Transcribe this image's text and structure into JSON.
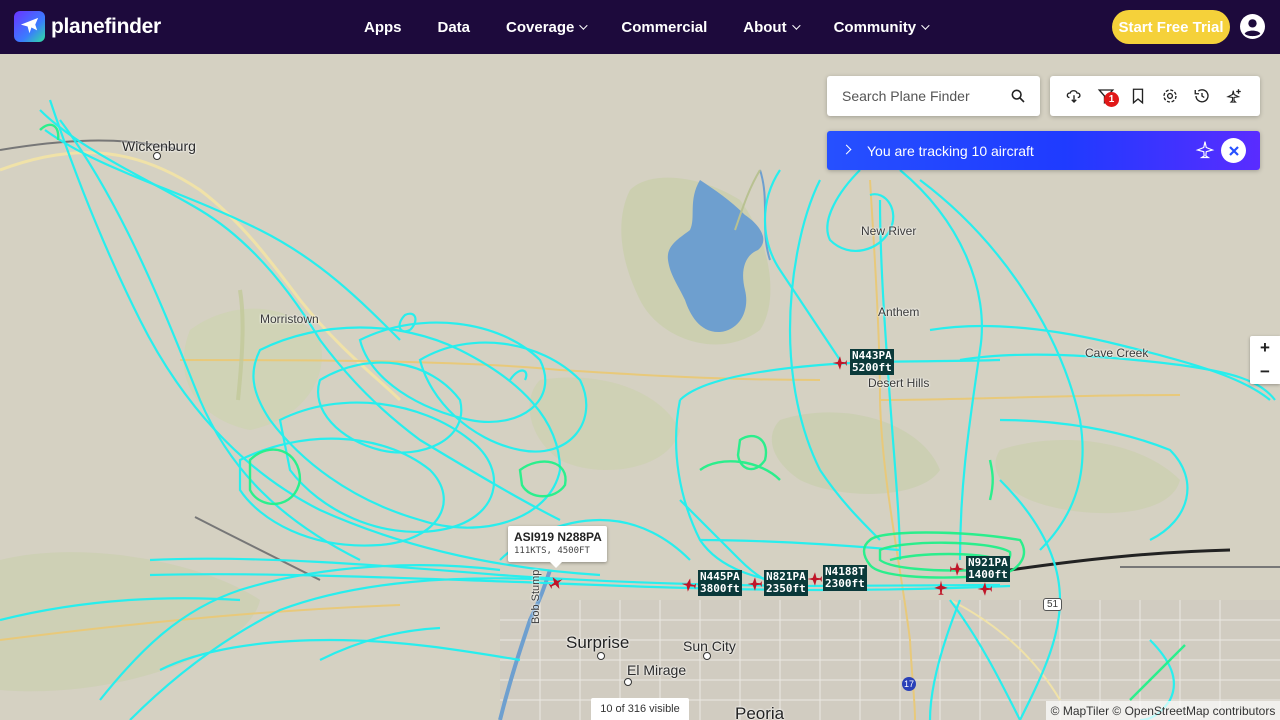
{
  "brand": {
    "name": "planefinder"
  },
  "nav": {
    "items": [
      {
        "label": "Apps",
        "dropdown": false
      },
      {
        "label": "Data",
        "dropdown": false
      },
      {
        "label": "Coverage",
        "dropdown": true
      },
      {
        "label": "Commercial",
        "dropdown": false
      },
      {
        "label": "About",
        "dropdown": true
      },
      {
        "label": "Community",
        "dropdown": true
      }
    ],
    "cta": "Start Free Trial"
  },
  "search": {
    "placeholder": "Search Plane Finder"
  },
  "toolbar": {
    "filter_badge": "1",
    "icons": [
      "weather-icon",
      "filter-icon",
      "bookmark-icon",
      "settings-icon",
      "history-icon",
      "add-plane-icon"
    ]
  },
  "tracking": {
    "text": "You are tracking 10 aircraft"
  },
  "map": {
    "places": {
      "wickenburg": "Wickenburg",
      "new_river": "New River",
      "anthem": "Anthem",
      "desert_hills": "Desert Hills",
      "cave_creek": "Cave Creek",
      "surprise": "Surprise",
      "sun_city": "Sun City",
      "el_mirage": "El Mirage",
      "peoria": "Peoria",
      "morristown": "Morristown",
      "bob_stump": "Bob Stump"
    },
    "aircraft": [
      {
        "callsign": "N443PA",
        "alt": "5200ft"
      },
      {
        "callsign": "N445PA",
        "alt": "3800ft"
      },
      {
        "callsign": "N821PA",
        "alt": "2350ft"
      },
      {
        "callsign": "N4188T",
        "alt": "2300ft"
      },
      {
        "callsign": "N921PA",
        "alt": "1400ft"
      }
    ],
    "popup": {
      "title": "ASI919 N288PA",
      "sub": "111KTS, 4500FT"
    },
    "route_markers": {
      "r51": "51",
      "i17": "17"
    }
  },
  "zoom": {
    "in": "+",
    "out": "−"
  },
  "footer": {
    "visible": "10 of 316 visible",
    "attribution": "© MapTiler © OpenStreetMap contributors"
  },
  "colors": {
    "nav_bg": "#1d0a3c",
    "cta": "#f5d13a",
    "track": "#1ff0f0",
    "track_green": "#22f08a",
    "plane": "#c01528",
    "label_bg": "#0b3a3a"
  }
}
